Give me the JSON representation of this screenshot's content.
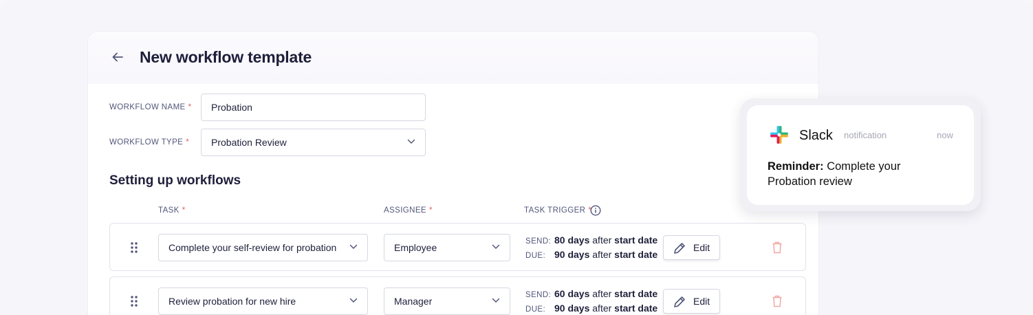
{
  "header": {
    "title": "New workflow template"
  },
  "form": {
    "name_label": "WORKFLOW NAME",
    "name_value": "Probation",
    "type_label": "WORKFLOW TYPE",
    "type_value": "Probation Review",
    "required_mark": "*"
  },
  "section": {
    "title": "Setting up workflows"
  },
  "columns": {
    "task": "TASK",
    "assignee": "ASSIGNEE",
    "trigger": "TASK TRIGGER"
  },
  "tasks": [
    {
      "task": "Complete your self-review for probation",
      "assignee": "Employee",
      "send_label": "SEND:",
      "send_days": "80 days",
      "send_after": "after",
      "send_ref": "start date",
      "due_label": "DUE:",
      "due_days": "90 days",
      "due_after": "after",
      "due_ref": "start date",
      "edit_label": "Edit"
    },
    {
      "task": "Review probation for new hire",
      "assignee": "Manager",
      "send_label": "SEND:",
      "send_days": "60 days",
      "send_after": "after",
      "send_ref": "start date",
      "due_label": "DUE:",
      "due_days": "90 days",
      "due_after": "after",
      "due_ref": "start date",
      "edit_label": "Edit"
    }
  ],
  "notification": {
    "app": "Slack",
    "kind": "notification",
    "time": "now",
    "title": "Reminder:",
    "message": "Complete your Probation review"
  },
  "colors": {
    "accent_text": "#1d1f3a",
    "label": "#51567a",
    "required": "#e0605e",
    "trash": "#f1a7a3"
  }
}
